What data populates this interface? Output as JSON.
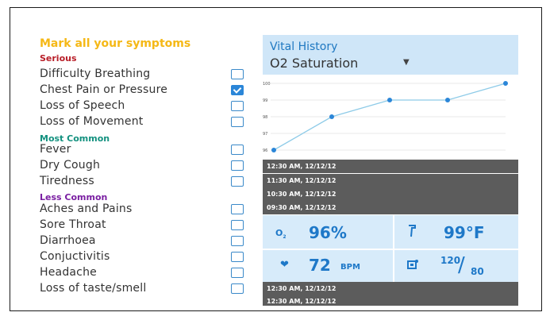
{
  "symptoms": {
    "heading": "Mark all your symptoms",
    "categories": {
      "serious": "Serious",
      "most_common": "Most Common",
      "less_common": "Less Common"
    },
    "items": [
      {
        "label": "Difficulty Breathing",
        "checked": false
      },
      {
        "label": "Chest Pain or Pressure",
        "checked": true
      },
      {
        "label": "Loss of Speech",
        "checked": false
      },
      {
        "label": "Loss of Movement",
        "checked": false
      },
      {
        "label": "Fever",
        "checked": false
      },
      {
        "label": "Dry Cough",
        "checked": false
      },
      {
        "label": "Tiredness",
        "checked": false
      },
      {
        "label": "Aches and Pains",
        "checked": false
      },
      {
        "label": "Sore Throat",
        "checked": false
      },
      {
        "label": "Diarrhoea",
        "checked": false
      },
      {
        "label": "Conjuctivitis",
        "checked": false
      },
      {
        "label": "Headache",
        "checked": false
      },
      {
        "label": "Loss of taste/smell",
        "checked": false
      }
    ]
  },
  "vital_history": {
    "title": "Vital History",
    "selected_metric": "O2 Saturation",
    "dropdown_icon": "caret-down-icon",
    "history_times": [
      "12:30 AM, 12/12/12",
      "11:30 AM, 12/12/12",
      "10:30 AM, 12/12/12",
      "09:30 AM, 12/12/12"
    ],
    "tiles": {
      "o2": {
        "icon": "o2-icon",
        "value": "96%"
      },
      "temp": {
        "icon": "thermometer-icon",
        "value": "99°F"
      },
      "heart": {
        "icon": "heart-icon",
        "value": "72",
        "unit": "BPM"
      },
      "bp": {
        "icon": "blood-pressure-icon",
        "systolic": "120",
        "diastolic": "80"
      }
    },
    "recent_times": [
      "12:30 AM, 12/12/12",
      "12:30 AM, 12/12/12"
    ]
  },
  "chart_data": {
    "type": "line",
    "y_ticks": [
      "100",
      "99",
      "98",
      "97",
      "96"
    ],
    "ylim": [
      96,
      100
    ],
    "values": [
      96,
      98,
      99,
      99,
      100
    ],
    "grid": true,
    "colors": {
      "line": "#8ecbe8",
      "point": "#2b86d8"
    }
  }
}
